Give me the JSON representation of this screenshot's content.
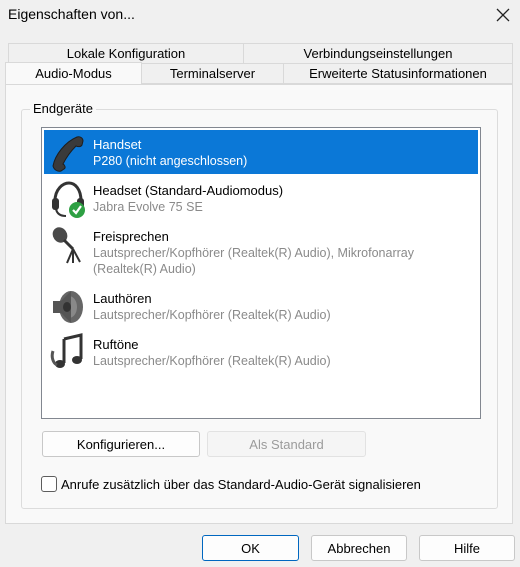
{
  "window": {
    "title": "Eigenschaften von..."
  },
  "tabs": {
    "row1": [
      {
        "label": "Lokale Konfiguration"
      },
      {
        "label": "Verbindungseinstellungen"
      }
    ],
    "row2": [
      {
        "label": "Audio-Modus",
        "active": true
      },
      {
        "label": "Terminalserver"
      },
      {
        "label": "Erweiterte Statusinformationen"
      }
    ]
  },
  "group": {
    "label": "Endgeräte"
  },
  "devices": [
    {
      "name": "Handset",
      "desc": "P280 (nicht angeschlossen)",
      "icon": "handset-icon",
      "selected": true
    },
    {
      "name": "Headset (Standard-Audiomodus)",
      "desc": "Jabra Evolve 75 SE",
      "icon": "headset-icon"
    },
    {
      "name": "Freisprechen",
      "desc": "Lautsprecher/Kopfhörer (Realtek(R) Audio), Mikrofonarray (Realtek(R) Audio)",
      "icon": "microphone-icon"
    },
    {
      "name": "Lauthören",
      "desc": "Lautsprecher/Kopfhörer (Realtek(R) Audio)",
      "icon": "speaker-icon"
    },
    {
      "name": "Ruftöne",
      "desc": "Lautsprecher/Kopfhörer (Realtek(R) Audio)",
      "icon": "ringtone-icon"
    }
  ],
  "buttons": {
    "configure": "Konfigurieren...",
    "set_default": "Als Standard",
    "ok": "OK",
    "cancel": "Abbrechen",
    "help": "Hilfe"
  },
  "checkbox": {
    "label": "Anrufe zusätzlich über das Standard-Audio-Gerät signalisieren",
    "checked": false
  },
  "colors": {
    "selection": "#0b78d7",
    "secondary_text": "#8a8a8a",
    "default_button_border": "#0067c0"
  }
}
